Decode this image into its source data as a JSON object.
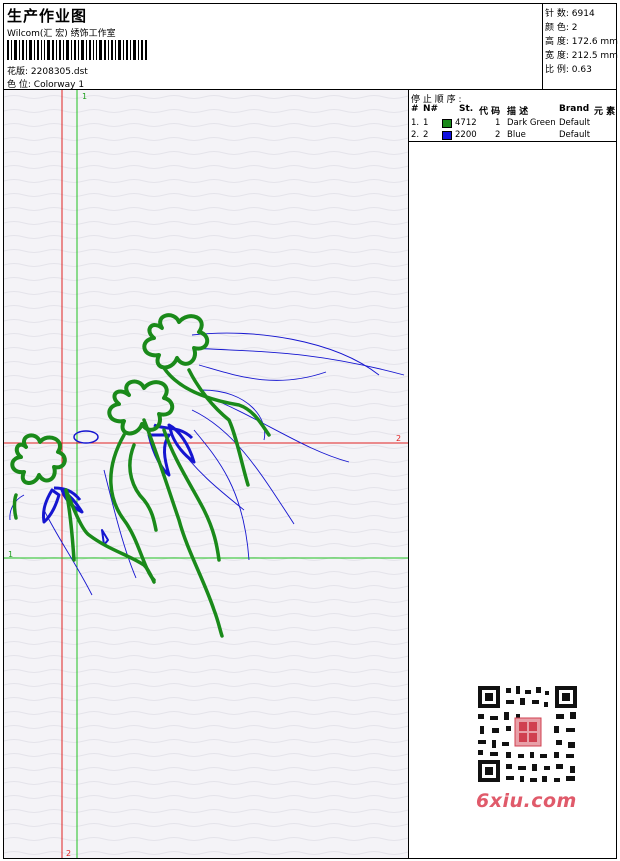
{
  "header": {
    "title": "生产作业图",
    "company": "Wilcom(汇 宏) 绣饰工作室",
    "design_label": "花版:",
    "design_file": "2208305.dst",
    "colorway_label": "色 位:",
    "colorway": "Colorway 1"
  },
  "stats": [
    {
      "label": "针 数:",
      "value": "6914"
    },
    {
      "label": "颜 色:",
      "value": "2"
    },
    {
      "label": "高 度:",
      "value": "172.6 mm"
    },
    {
      "label": "宽 度:",
      "value": "212.5 mm"
    },
    {
      "label": "比 例:",
      "value": "0.63"
    }
  ],
  "stop_sequence": {
    "label": "停 止 顺 序 :",
    "columns": [
      "#",
      "N#",
      "St.",
      "代 码",
      "描 述",
      "Brand",
      "元 素"
    ],
    "rows": [
      {
        "no": "1.",
        "n": "1",
        "color": "#1a8a1a",
        "code": "4712",
        "st": "1",
        "desc": "Dark Green",
        "brand": "Default"
      },
      {
        "no": "2.",
        "n": "2",
        "color": "#1010e0",
        "code": "2200",
        "st": "2",
        "desc": "Blue",
        "brand": "Default"
      }
    ]
  },
  "guides": {
    "label_1": "1",
    "label_2": "2"
  },
  "colors": {
    "green": "#1a8a1a",
    "blue": "#1515d0",
    "guide_red": "#e02020",
    "guide_green": "#20c020"
  },
  "watermark": "6xiu.com"
}
